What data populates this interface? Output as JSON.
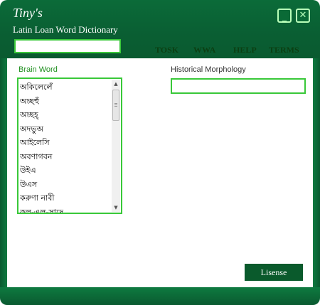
{
  "window": {
    "title": "Tiny's",
    "subtitle": "Latin Loan Word Dictionary",
    "minimize_icon": "minimize-icon",
    "close_icon": "close-icon"
  },
  "toolbar": {
    "search_value": "",
    "nav": [
      "TOSK",
      "WWA",
      "HELP",
      "TERMS"
    ]
  },
  "brain_word": {
    "label": "Brain Word",
    "items": [
      "অকিলেলেঁ",
      "অচ্ছহুঁ",
      "অচ্ছহ্",
      "অদভুঅ",
      "আইলেসি",
      "অবণাগবন",
      "উইএ",
      "উএস",
      "করুণা নাবী",
      "কল-এল-সাদে"
    ]
  },
  "historical_morphology": {
    "label": "Historical Morphology",
    "value": ""
  },
  "license_button": "Lisense",
  "colors": {
    "brand_green": "#0a5a30",
    "accent_green": "#39c839",
    "label_green": "#1e8f1e",
    "nav_text": "#0b3f12"
  }
}
